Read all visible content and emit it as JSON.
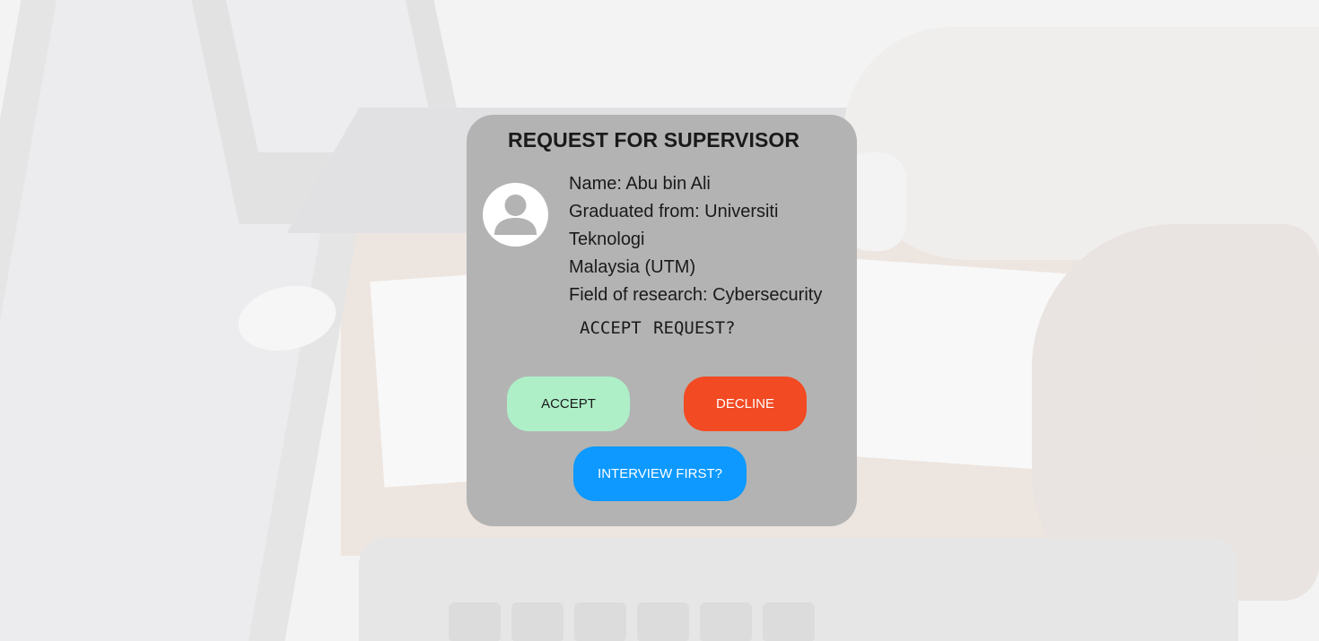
{
  "dialog": {
    "title": "REQUEST FOR SUPERVISOR",
    "avatar_icon": "user-avatar-icon",
    "info_lines": [
      "Name: Abu bin Ali",
      "Graduated from: Universiti",
      "Teknologi",
      "Malaysia (UTM)",
      "Field of research: Cybersecurity"
    ],
    "question": "ACCEPT REQUEST?",
    "buttons": {
      "accept": "ACCEPT",
      "decline": "DECLINE",
      "interview": "INTERVIEW FIRST?"
    }
  },
  "colors": {
    "card": "#b3b3b3",
    "accept": "#aeefc8",
    "decline": "#f24a22",
    "interview": "#0d99ff"
  }
}
